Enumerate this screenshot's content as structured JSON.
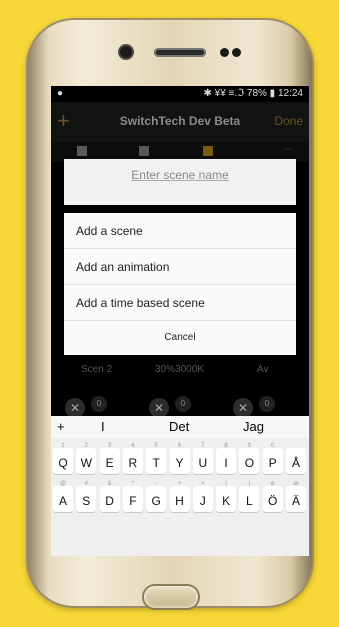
{
  "status_bar": {
    "left_icon": "notification-icon",
    "right_text": "✱ ¥¥ ≡.ℑ 78% ▮ 12:24",
    "battery": "78%",
    "time": "12:24"
  },
  "app_bar": {
    "add_label": "+",
    "title": "SwitchTech Dev Beta",
    "done_label": "Done"
  },
  "tabs": [
    "lamp-tab",
    "scene-tab",
    "animation-tab",
    "more-tab"
  ],
  "background_row": {
    "scene": "Scen 2",
    "value": "30%3000K",
    "state": "Av"
  },
  "background_badges": [
    "0",
    "0",
    "0"
  ],
  "scene_name_dialog": {
    "placeholder": "Enter scene name"
  },
  "add_menu": {
    "items": [
      "Add a scene",
      "Add an animation",
      "Add a time based scene"
    ],
    "cancel_label": "Cancel"
  },
  "keyboard": {
    "suggestions": [
      "+",
      "I",
      "Det",
      "Jag"
    ],
    "row1": [
      "Q",
      "W",
      "E",
      "R",
      "T",
      "Y",
      "U",
      "I",
      "O",
      "P",
      "Å"
    ],
    "row1_hints": [
      "1",
      "2",
      "3",
      "4",
      "5",
      "6",
      "7",
      "8",
      "9",
      "0",
      ""
    ],
    "row2": [
      "A",
      "S",
      "D",
      "F",
      "G",
      "H",
      "J",
      "K",
      "L",
      "Ö",
      "Ä"
    ],
    "row2_hints": [
      "@",
      "#",
      "&",
      "*",
      "-",
      "+",
      "=",
      "(",
      ")",
      "ø",
      "æ"
    ]
  },
  "colors": {
    "background": "#f7d837",
    "accent": "#6a5420"
  }
}
